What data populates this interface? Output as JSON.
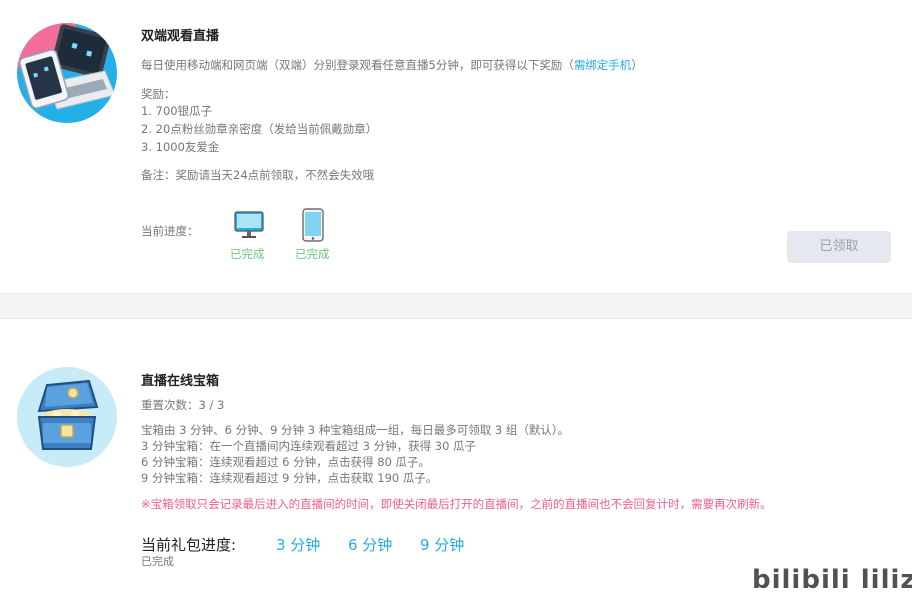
{
  "task1": {
    "title": "双端观看直播",
    "desc_prefix": "每日使用移动端和网页端（双端）分别登录观看任意直播5分钟，即可获得以下奖励（",
    "desc_link": "需绑定手机",
    "desc_suffix": "）",
    "reward_header": "奖励：",
    "rewards": [
      "1. 700银瓜子",
      "2. 20点粉丝勋章亲密度（发给当前佩戴勋章）",
      "3. 1000友爱金"
    ],
    "note": "备注：奖励请当天24点前领取，不然会失效哦",
    "progress_label": "当前进度：",
    "pc_status": "已完成",
    "mobile_status": "已完成",
    "claim_button": "已领取"
  },
  "task2": {
    "title": "直播在线宝箱",
    "reset_count": "重置次数：3 / 3",
    "lines": [
      "宝箱由 3 分钟、6 分钟、9 分钟 3 种宝箱组成一组，每日最多可领取 3 组（默认）。",
      "3 分钟宝箱：在一个直播间内连续观看超过 3 分钟，获得 30 瓜子",
      "6 分钟宝箱：连续观看超过 6 分钟，点击获得 80 瓜子。",
      "9 分钟宝箱：连续观看超过 9 分钟，点击获取 190 瓜子。"
    ],
    "warning": "※宝箱领取只会记录最后进入的直播间的时间，即使关闭最后打开的直播间，之前的直播间也不会回复计时，需要再次刷新。",
    "progress_label": "当前礼包进度:",
    "steps": [
      "3 分钟",
      "6 分钟",
      "9 分钟"
    ],
    "progress_status": "已完成"
  },
  "watermark": "bilibili lilizgj",
  "icons": {
    "task1": "laptop-tablet-mascot-icon",
    "task2": "treasure-chest-icon",
    "pc": "desktop-monitor-icon",
    "mobile": "mobile-phone-icon"
  },
  "colors": {
    "accent": "#23ade5",
    "done": "#6dc781",
    "warning": "#f25d8e",
    "button_bg": "#e5e9ef"
  }
}
